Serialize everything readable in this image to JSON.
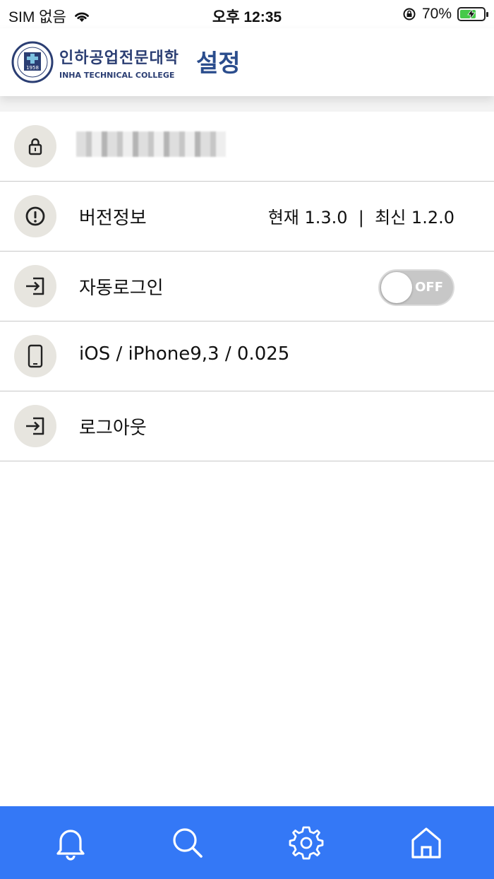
{
  "status_bar": {
    "carrier": "SIM 없음",
    "time": "오후 12:35",
    "battery_percent": "70%",
    "battery_level": 0.7
  },
  "header": {
    "logo_korean": "인하공업전문대학",
    "logo_english": "INHA TECHNICAL COLLEGE",
    "logo_year": "1958",
    "title": "설정"
  },
  "settings": {
    "account": {
      "icon": "lock-icon"
    },
    "version": {
      "label": "버전정보",
      "value": "현재 1.3.0  |  최신 1.2.0",
      "icon": "alert-circle-icon"
    },
    "auto_login": {
      "label": "자동로그인",
      "toggle_text": "OFF",
      "icon": "login-icon"
    },
    "device": {
      "label": "iOS / iPhone9,3 / 0.025",
      "icon": "phone-icon"
    },
    "logout": {
      "label": "로그아웃",
      "icon": "login-icon"
    }
  },
  "bottom_nav": {
    "items": [
      "bell-icon",
      "search-icon",
      "gear-icon",
      "home-icon"
    ],
    "background": "#3478f6"
  }
}
